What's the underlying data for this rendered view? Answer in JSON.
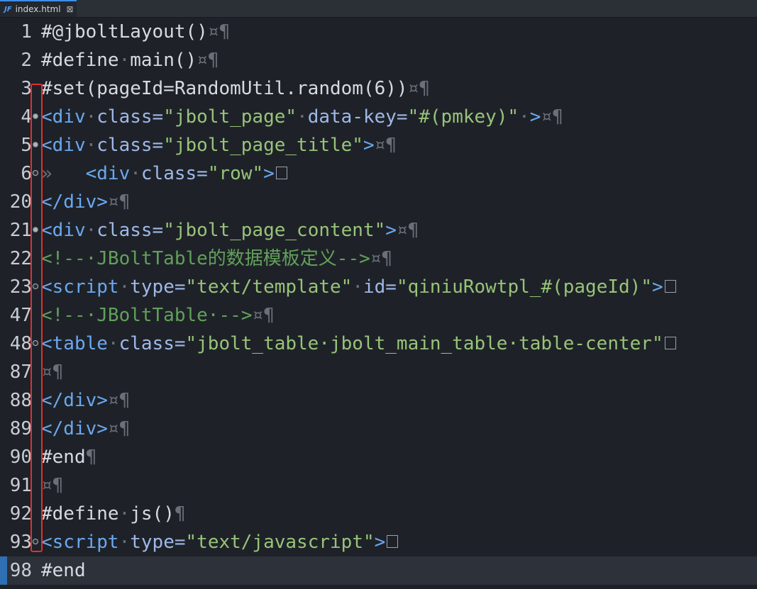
{
  "tab": {
    "icon": "JF",
    "filename": "index.html",
    "close": "⊠"
  },
  "lines": [
    {
      "num": "1",
      "segs": [
        [
          "dir",
          "#@jboltLayout()"
        ],
        [
          "ws",
          "¤¶"
        ]
      ]
    },
    {
      "num": "2",
      "segs": [
        [
          "dir",
          "#define"
        ],
        [
          "ws",
          "·"
        ],
        [
          "dir",
          "main()"
        ],
        [
          "ws",
          "¤¶"
        ]
      ]
    },
    {
      "num": "3",
      "segs": [
        [
          "dir",
          "#set(pageId=RandomUtil.random(6))"
        ],
        [
          "ws",
          "¤¶"
        ]
      ]
    },
    {
      "num": "4",
      "fold": "open",
      "segs": [
        [
          "tag",
          "<div"
        ],
        [
          "ws",
          "·"
        ],
        [
          "attr",
          "class="
        ],
        [
          "str",
          "\"jbolt_page\""
        ],
        [
          "ws",
          "·"
        ],
        [
          "attr",
          "data-key="
        ],
        [
          "str",
          "\"#(pmkey)\""
        ],
        [
          "ws",
          "·"
        ],
        [
          "tag",
          ">"
        ],
        [
          "ws",
          "¤¶"
        ]
      ]
    },
    {
      "num": "5",
      "fold": "open",
      "segs": [
        [
          "tag",
          "<div"
        ],
        [
          "ws",
          "·"
        ],
        [
          "attr",
          "class="
        ],
        [
          "str",
          "\"jbolt_page_title\""
        ],
        [
          "tag",
          ">"
        ],
        [
          "ws",
          "¤¶"
        ]
      ]
    },
    {
      "num": "6",
      "fold": "plus",
      "collapsed": true,
      "segs": [
        [
          "ws",
          "»   "
        ],
        [
          "tag",
          "<div"
        ],
        [
          "ws",
          "·"
        ],
        [
          "attr",
          "class="
        ],
        [
          "str",
          "\"row\""
        ],
        [
          "tag",
          ">"
        ]
      ]
    },
    {
      "num": "20",
      "segs": [
        [
          "tag",
          "</div>"
        ],
        [
          "ws",
          "¤¶"
        ]
      ]
    },
    {
      "num": "21",
      "fold": "open",
      "segs": [
        [
          "tag",
          "<div"
        ],
        [
          "ws",
          "·"
        ],
        [
          "attr",
          "class="
        ],
        [
          "str",
          "\"jbolt_page_content\""
        ],
        [
          "tag",
          ">"
        ],
        [
          "ws",
          "¤¶"
        ]
      ]
    },
    {
      "num": "22",
      "segs": [
        [
          "comment",
          "<!--·JBoltTable的数据模板定义-->"
        ],
        [
          "ws",
          "¤¶"
        ]
      ]
    },
    {
      "num": "23",
      "fold": "plus",
      "collapsed": true,
      "segs": [
        [
          "tag",
          "<script"
        ],
        [
          "ws",
          "·"
        ],
        [
          "attr",
          "type="
        ],
        [
          "str",
          "\"text/template\""
        ],
        [
          "ws",
          "·"
        ],
        [
          "attr",
          "id="
        ],
        [
          "str",
          "\"qiniuRowtpl_#(pageId)\""
        ],
        [
          "tag",
          ">"
        ]
      ]
    },
    {
      "num": "47",
      "segs": [
        [
          "comment",
          "<!--·JBoltTable·-->"
        ],
        [
          "ws",
          "¤¶"
        ]
      ]
    },
    {
      "num": "48",
      "fold": "plus",
      "collapsed": true,
      "segs": [
        [
          "tag",
          "<table"
        ],
        [
          "ws",
          "·"
        ],
        [
          "attr",
          "class="
        ],
        [
          "str",
          "\"jbolt_table·jbolt_main_table·table-center\""
        ]
      ]
    },
    {
      "num": "87",
      "segs": [
        [
          "ws",
          "¤¶"
        ]
      ]
    },
    {
      "num": "88",
      "segs": [
        [
          "tag",
          "</div>"
        ],
        [
          "ws",
          "¤¶"
        ]
      ]
    },
    {
      "num": "89",
      "segs": [
        [
          "tag",
          "</div>"
        ],
        [
          "ws",
          "¤¶"
        ]
      ]
    },
    {
      "num": "90",
      "segs": [
        [
          "dir",
          "#end"
        ],
        [
          "ws",
          "¶"
        ]
      ]
    },
    {
      "num": "91",
      "segs": [
        [
          "ws",
          "¤¶"
        ]
      ]
    },
    {
      "num": "92",
      "segs": [
        [
          "dir",
          "#define"
        ],
        [
          "ws",
          "·"
        ],
        [
          "dir",
          "js()"
        ],
        [
          "ws",
          "¶"
        ]
      ]
    },
    {
      "num": "93",
      "fold": "plus",
      "collapsed": true,
      "segs": [
        [
          "tag",
          "<script"
        ],
        [
          "ws",
          "·"
        ],
        [
          "attr",
          "type="
        ],
        [
          "str",
          "\"text/javascript\""
        ],
        [
          "tag",
          ">"
        ]
      ]
    },
    {
      "num": "98",
      "current": true,
      "segs": [
        [
          "dir",
          "#end"
        ]
      ]
    }
  ],
  "colors": {
    "background": "#1e2228",
    "current_line": "#2c313a",
    "tag": "#6aa8f0",
    "string": "#98c379",
    "comment": "#62a05a",
    "highlight_box": "#e03030"
  }
}
